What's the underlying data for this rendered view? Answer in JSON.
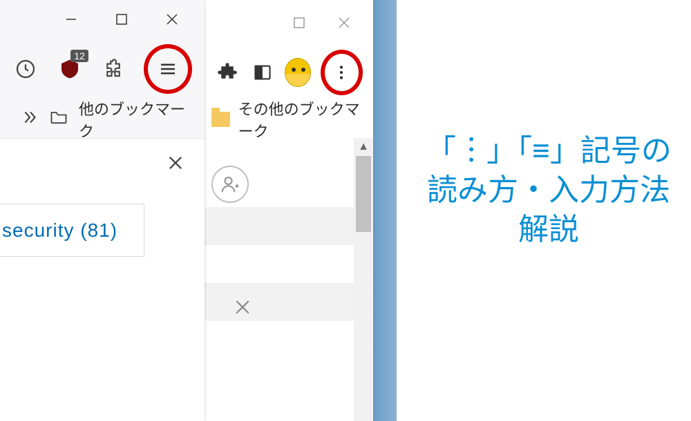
{
  "left": {
    "window": {
      "minimize": "−",
      "maximize": "☐",
      "close": "×"
    },
    "badge": "12",
    "bookmarks_label": "他のブックマーク",
    "tab_label": "security (81)"
  },
  "mid": {
    "bookmarks_label": "その他のブックマーク"
  },
  "title": {
    "line1": "「︙」「≡」記号の",
    "line2": "読み方・入力方法",
    "line3": "解説"
  }
}
